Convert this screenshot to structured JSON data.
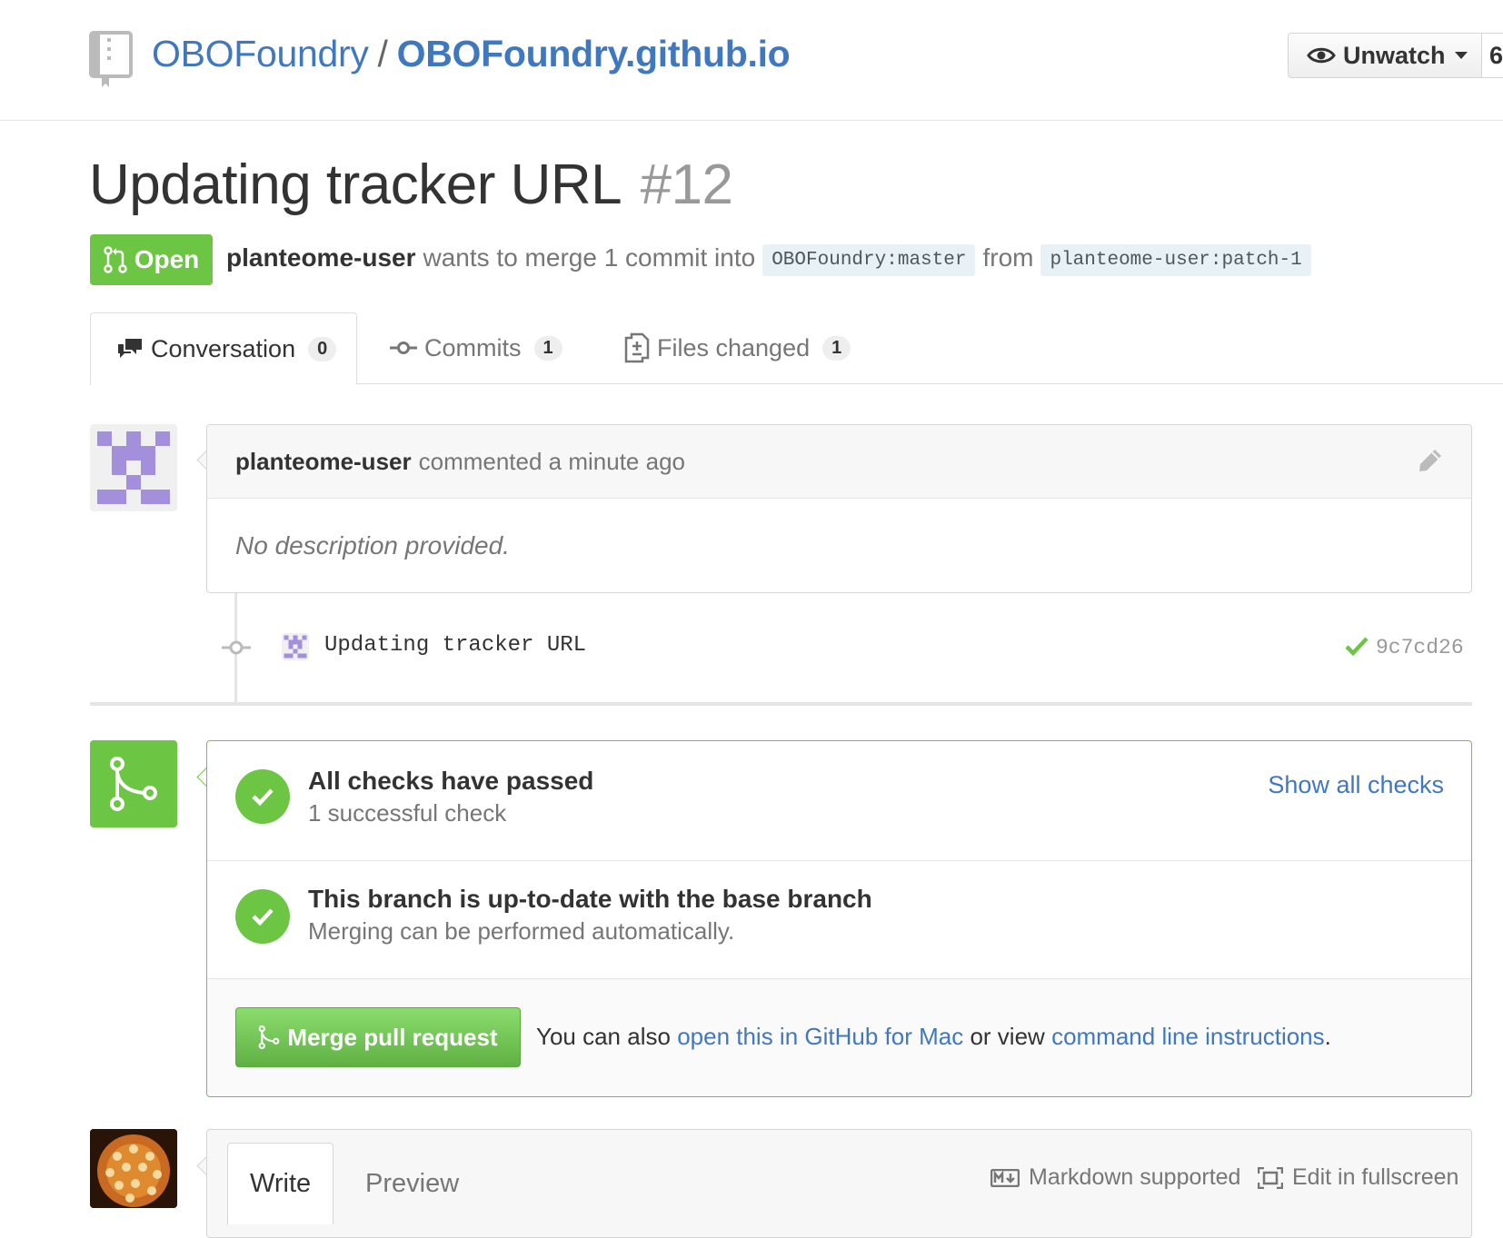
{
  "repo": {
    "owner": "OBOFoundry",
    "separator": "/",
    "name": "OBOFoundry.github.io",
    "watch_label": "Unwatch",
    "watch_count": "6"
  },
  "pr": {
    "title": "Updating tracker URL",
    "number": "#12",
    "state": "Open",
    "author": "planteome-user",
    "merge_text": "wants to merge 1 commit into",
    "base_owner": "OBOFoundry",
    "base_branch": "master",
    "from_text": "from",
    "head_owner": "planteome-user",
    "head_branch": "patch-1"
  },
  "tabs": [
    {
      "label": "Conversation",
      "count": "0"
    },
    {
      "label": "Commits",
      "count": "1"
    },
    {
      "label": "Files changed",
      "count": "1"
    }
  ],
  "comment": {
    "author": "planteome-user",
    "action": "commented a minute ago",
    "body": "No description provided."
  },
  "commit": {
    "message": "Updating tracker URL",
    "sha": "9c7cd26"
  },
  "merge": {
    "checks_title": "All checks have passed",
    "checks_sub": "1 successful check",
    "show_checks": "Show all checks",
    "branch_title": "This branch is up-to-date with the base branch",
    "branch_sub": "Merging can be performed automatically.",
    "button": "Merge pull request",
    "alt_prefix": "You can also",
    "alt_link1": "open this in GitHub for Mac",
    "alt_mid": "or view",
    "alt_link2": "command line instructions",
    "alt_suffix": "."
  },
  "write": {
    "tab_write": "Write",
    "tab_preview": "Preview",
    "markdown": "Markdown supported",
    "fullscreen": "Edit in fullscreen"
  },
  "colors": {
    "link": "#4078c0",
    "success": "#6cc644",
    "branch_bg": "#e8f1f6"
  }
}
